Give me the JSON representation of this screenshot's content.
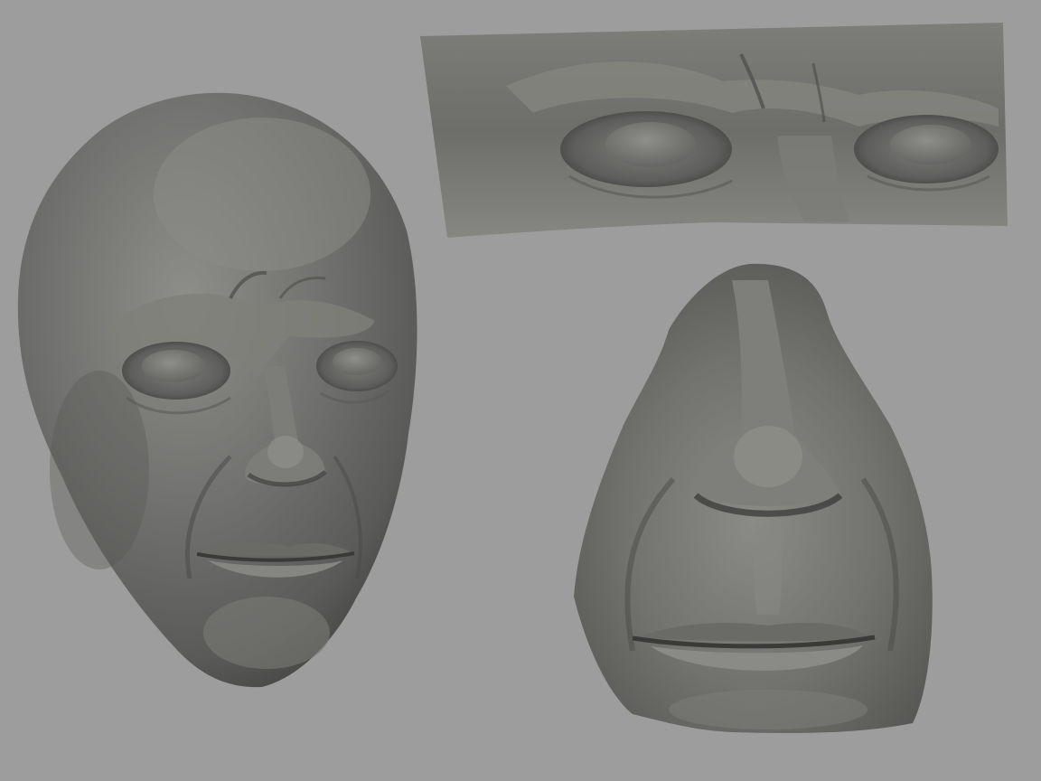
{
  "viewport": {
    "background": "#9d9d9d"
  },
  "sculpts": [
    {
      "name": "full-head-sculpt",
      "material": "matcap-clay-grey",
      "base_color": "#6f6f6c"
    },
    {
      "name": "eyes-brow-crop-sculpt",
      "material": "matcap-clay-grey",
      "base_color": "#6f6f6c"
    },
    {
      "name": "nose-mouth-crop-sculpt",
      "material": "matcap-clay-grey",
      "base_color": "#6f6f6c"
    }
  ]
}
